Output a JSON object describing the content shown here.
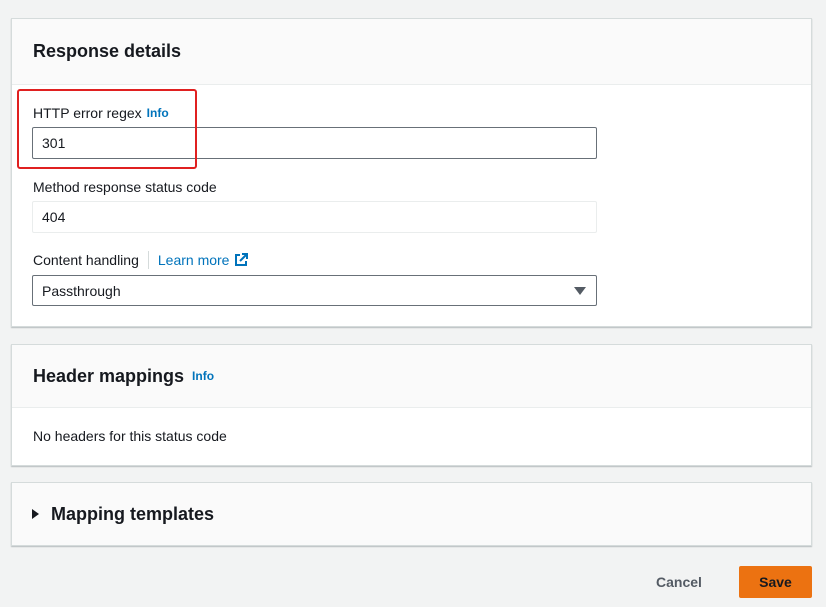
{
  "response_details": {
    "title": "Response details",
    "regex_label": "HTTP error regex",
    "regex_info": "Info",
    "regex_value": "301",
    "status_label": "Method response status code",
    "status_value": "404",
    "content_label": "Content handling",
    "learn_more": "Learn more",
    "content_value": "Passthrough"
  },
  "header_mappings": {
    "title": "Header mappings",
    "info": "Info",
    "empty_text": "No headers for this status code"
  },
  "mapping_templates": {
    "title": "Mapping templates",
    "expanded": false
  },
  "footer": {
    "cancel_label": "Cancel",
    "save_label": "Save"
  },
  "colors": {
    "link": "#0073bb",
    "primary_button": "#ec7211",
    "highlight": "#e02020"
  },
  "icons": [
    "external-link-icon",
    "caret-down-icon",
    "expand-triangle-icon"
  ]
}
